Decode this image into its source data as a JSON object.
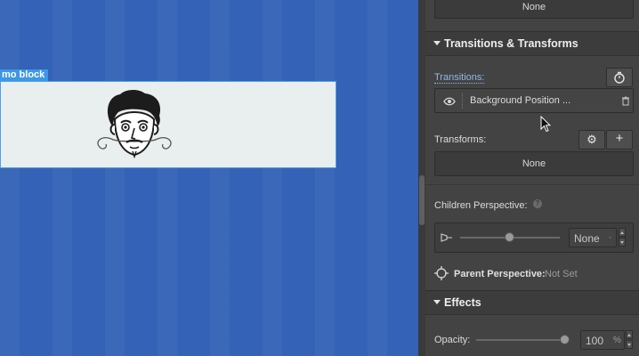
{
  "canvas": {
    "block_tag": "mo block"
  },
  "panel": {
    "top_value": "None",
    "transitions_section": {
      "title": "Transitions & Transforms",
      "transitions_label": "Transitions:",
      "transition_item": "Background Position ...",
      "transforms_label": "Transforms:",
      "transforms_value": "None",
      "children_perspective_label": "Children Perspective:",
      "perspective_value": "None",
      "perspective_slider_fraction": 0.5,
      "parent_perspective_label": "Parent Perspective:",
      "parent_perspective_value": "Not Set"
    },
    "effects_section": {
      "title": "Effects",
      "opacity_label": "Opacity:",
      "opacity_value": "100",
      "opacity_unit": "%",
      "opacity_slider_fraction": 1.0
    }
  },
  "colors": {
    "canvas_bg": "#3462b6",
    "panel_bg": "#434343",
    "selection_accent": "#3d97e6",
    "transitions_label_color": "#8fb9e8"
  }
}
